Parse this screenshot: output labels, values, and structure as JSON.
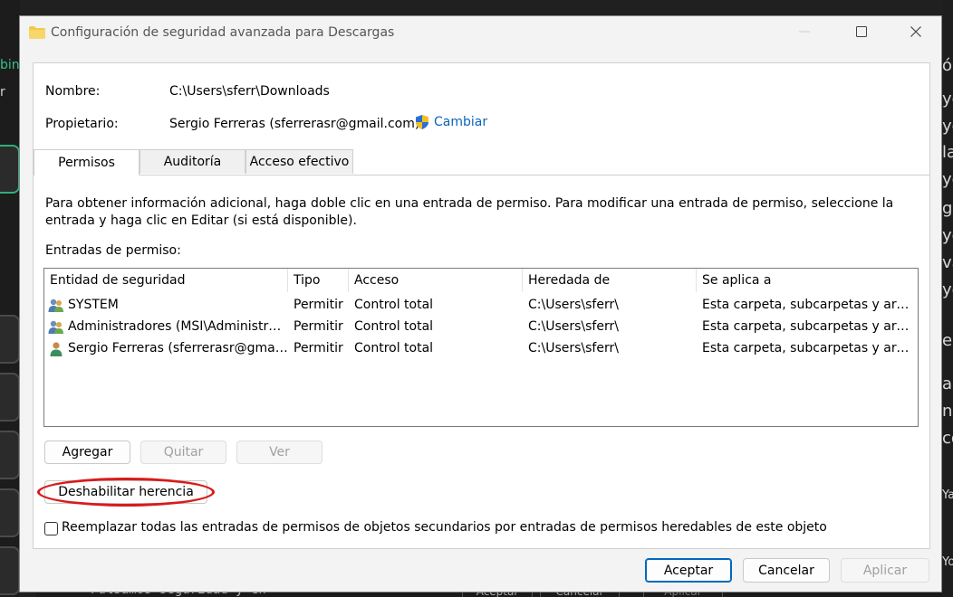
{
  "background": {
    "left_fragments": [
      "bini",
      "r"
    ],
    "right_fragments": [
      "ó",
      "ye",
      "ye",
      "la",
      "ye",
      "g",
      "ye",
      "va",
      "ye",
      "es",
      "ab",
      "no",
      "co",
      "Ya",
      "Yo"
    ],
    "bottom_code": "Pulsamos seguridad y en",
    "bottom_buttons": [
      "Aceptar",
      "Cancelar",
      "Aplicar"
    ]
  },
  "dialog": {
    "title": "Configuración de seguridad avanzada para Descargas",
    "name_label": "Nombre:",
    "name_value": "C:\\Users\\sferr\\Downloads",
    "owner_label": "Propietario:",
    "owner_value": "Sergio Ferreras (sferrerasr@gmail.com)",
    "change_link": "Cambiar",
    "tabs": [
      "Permisos",
      "Auditoría",
      "Acceso efectivo"
    ],
    "description": "Para obtener información adicional, haga doble clic en una entrada de permiso. Para modificar una entrada de permiso, seleccione la entrada y haga clic en Editar (si está disponible).",
    "entries_label": "Entradas de permiso:",
    "columns": [
      "Entidad de seguridad",
      "Tipo",
      "Acceso",
      "Heredada de",
      "Se aplica a"
    ],
    "rows": [
      {
        "entity": "SYSTEM",
        "type": "Permitir",
        "access": "Control total",
        "inherited": "C:\\Users\\sferr\\",
        "applies": "Esta carpeta, subcarpetas y archivos",
        "icon": "group-users-icon"
      },
      {
        "entity": "Administradores (MSI\\Administradores)",
        "type": "Permitir",
        "access": "Control total",
        "inherited": "C:\\Users\\sferr\\",
        "applies": "Esta carpeta, subcarpetas y archivos",
        "icon": "group-users-icon"
      },
      {
        "entity": "Sergio Ferreras (sferrerasr@gmail.com)",
        "type": "Permitir",
        "access": "Control total",
        "inherited": "C:\\Users\\sferr\\",
        "applies": "Esta carpeta, subcarpetas y archivos",
        "icon": "user-icon"
      }
    ],
    "buttons": {
      "add": "Agregar",
      "remove": "Quitar",
      "view": "Ver",
      "disable_inheritance": "Deshabilitar herencia"
    },
    "replace_checkbox": "Reemplazar todas las entradas de permisos de objetos secundarios por entradas de permisos heredables de este objeto",
    "replace_checked": false,
    "footer": {
      "ok": "Aceptar",
      "cancel": "Cancelar",
      "apply": "Aplicar"
    },
    "colors": {
      "accent": "#0067c0",
      "link": "#0a64b8",
      "highlight_ellipse": "#d81b1b"
    }
  }
}
